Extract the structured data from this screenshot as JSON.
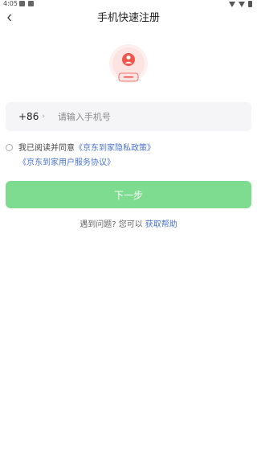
{
  "status_bar": {
    "time": "4:05"
  },
  "header": {
    "title": "手机快速注册",
    "back_icon": "chevron-left-icon"
  },
  "logo": {
    "icon": "user-avatar-icon",
    "accent": "#f0554a"
  },
  "phone": {
    "country_code": "+86",
    "placeholder": "请输入手机号"
  },
  "agreement": {
    "prefix": "我已阅读并同意",
    "privacy_link": "《京东到家隐私政策》",
    "service_link": "《京东到家用户服务协议》"
  },
  "next_button": {
    "label": "下一步",
    "color": "#7ddc8f"
  },
  "help": {
    "question": "遇到问题? 您可以",
    "link": "获取帮助"
  },
  "colors": {
    "link": "#4a74c9",
    "input_bg": "#f5f5f7"
  }
}
